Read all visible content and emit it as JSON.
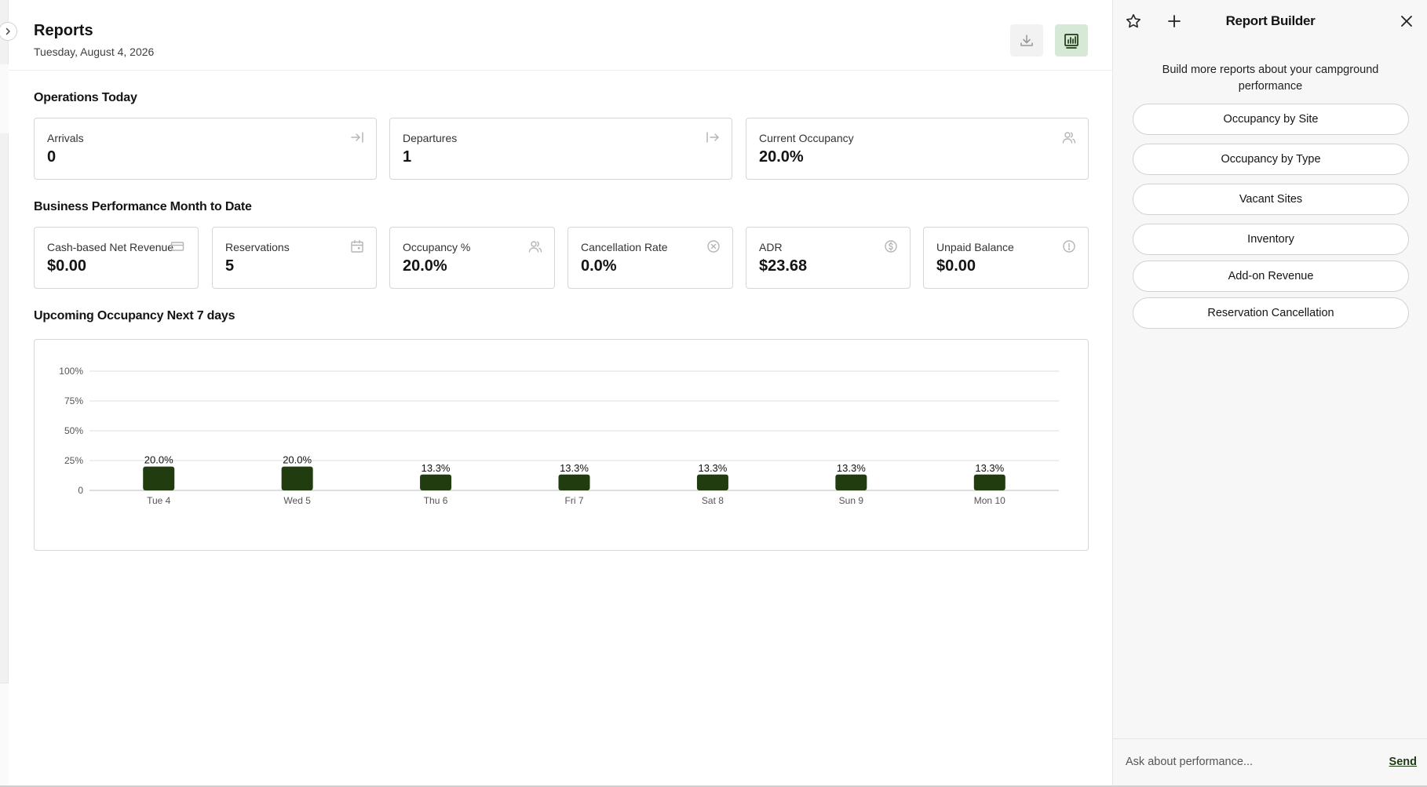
{
  "header": {
    "title": "Reports",
    "date": "Tuesday, August 4, 2026",
    "download_icon": "download-icon",
    "report_icon": "bar-chart-icon"
  },
  "operations": {
    "title": "Operations Today",
    "cards": [
      {
        "label": "Arrivals",
        "value": "0",
        "icon": "arrow-in-icon"
      },
      {
        "label": "Departures",
        "value": "1",
        "icon": "arrow-out-icon"
      },
      {
        "label": "Current Occupancy",
        "value": "20.0%",
        "icon": "users-icon"
      }
    ]
  },
  "business": {
    "title": "Business Performance Month to Date",
    "cards": [
      {
        "label": "Cash-based Net Revenue",
        "value": "$0.00",
        "icon": "credit-card-icon"
      },
      {
        "label": "Reservations",
        "value": "5",
        "icon": "calendar-icon"
      },
      {
        "label": "Occupancy %",
        "value": "20.0%",
        "icon": "users-icon"
      },
      {
        "label": "Cancellation Rate",
        "value": "0.0%",
        "icon": "x-circle-icon"
      },
      {
        "label": "ADR",
        "value": "$23.68",
        "icon": "dollar-circle-icon"
      },
      {
        "label": "Unpaid Balance",
        "value": "$0.00",
        "icon": "alert-circle-icon"
      }
    ]
  },
  "upcoming": {
    "title": "Upcoming Occupancy Next 7 days"
  },
  "chart_data": {
    "type": "bar",
    "categories": [
      "Tue 4",
      "Wed 5",
      "Thu 6",
      "Fri 7",
      "Sat 8",
      "Sun 9",
      "Mon 10"
    ],
    "values": [
      20.0,
      20.0,
      13.3,
      13.3,
      13.3,
      13.3,
      13.3
    ],
    "data_labels": [
      "20.0%",
      "20.0%",
      "13.3%",
      "13.3%",
      "13.3%",
      "13.3%",
      "13.3%"
    ],
    "yticks": [
      0,
      25,
      50,
      75,
      100
    ],
    "ytick_labels": [
      "0",
      "25%",
      "50%",
      "75%",
      "100%"
    ],
    "ylim": [
      0,
      100
    ],
    "grid": true,
    "bar_color": "#213d0f"
  },
  "panel": {
    "title": "Report Builder",
    "intro": "Build more reports about your campground performance",
    "reports": [
      "Occupancy by Site",
      "Occupancy by Type",
      "Vacant Sites",
      "Inventory",
      "Add-on Revenue",
      "Reservation Cancellation"
    ],
    "ask_placeholder": "Ask about performance...",
    "send_label": "Send"
  },
  "colors": {
    "accent_dark_green": "#213d0f",
    "accent_light_green": "#d6e8d6",
    "border": "#d6d6d6",
    "panel_bg": "#f7f7f7"
  }
}
